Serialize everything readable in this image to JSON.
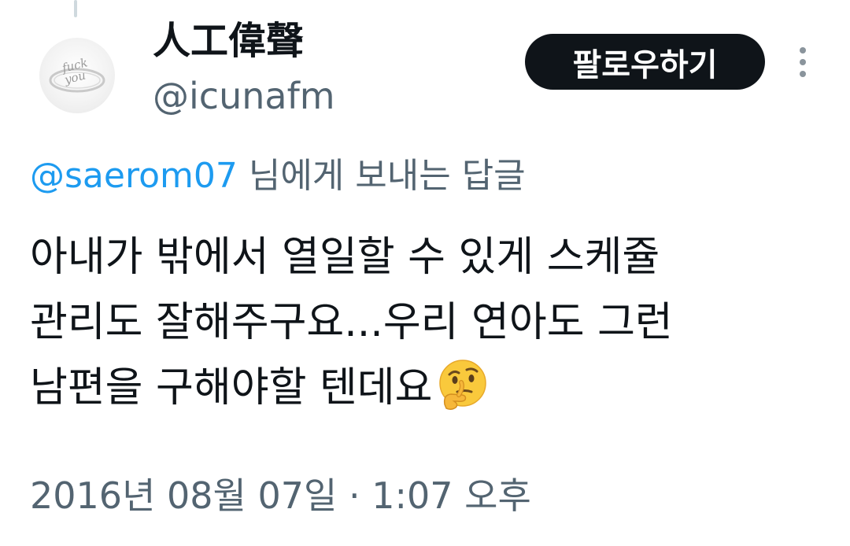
{
  "tweet": {
    "author": {
      "display_name": "人工偉聲",
      "handle": "@icunafm",
      "avatar_icon": "ring-photo-avatar",
      "avatar_text": "fuck you"
    },
    "follow_button_label": "팔로우하기",
    "more_icon": "more-vertical-icon",
    "reply_to": {
      "mention": "@saerom07",
      "suffix": " 님에게 보내는 답글"
    },
    "text_lines": [
      "아내가 밖에서 열일할 수 있게 스케쥴",
      "관리도 잘해주구요...우리 연아도 그런",
      "남편을 구해야할 텐데요"
    ],
    "emoji": "thinking-face",
    "timestamp": "2016년 08월 07일 · 1:07 오후"
  },
  "colors": {
    "text_primary": "#0f1419",
    "text_secondary": "#536471",
    "link": "#1d9bf0",
    "button_bg": "#0f1419",
    "button_text": "#ffffff"
  }
}
